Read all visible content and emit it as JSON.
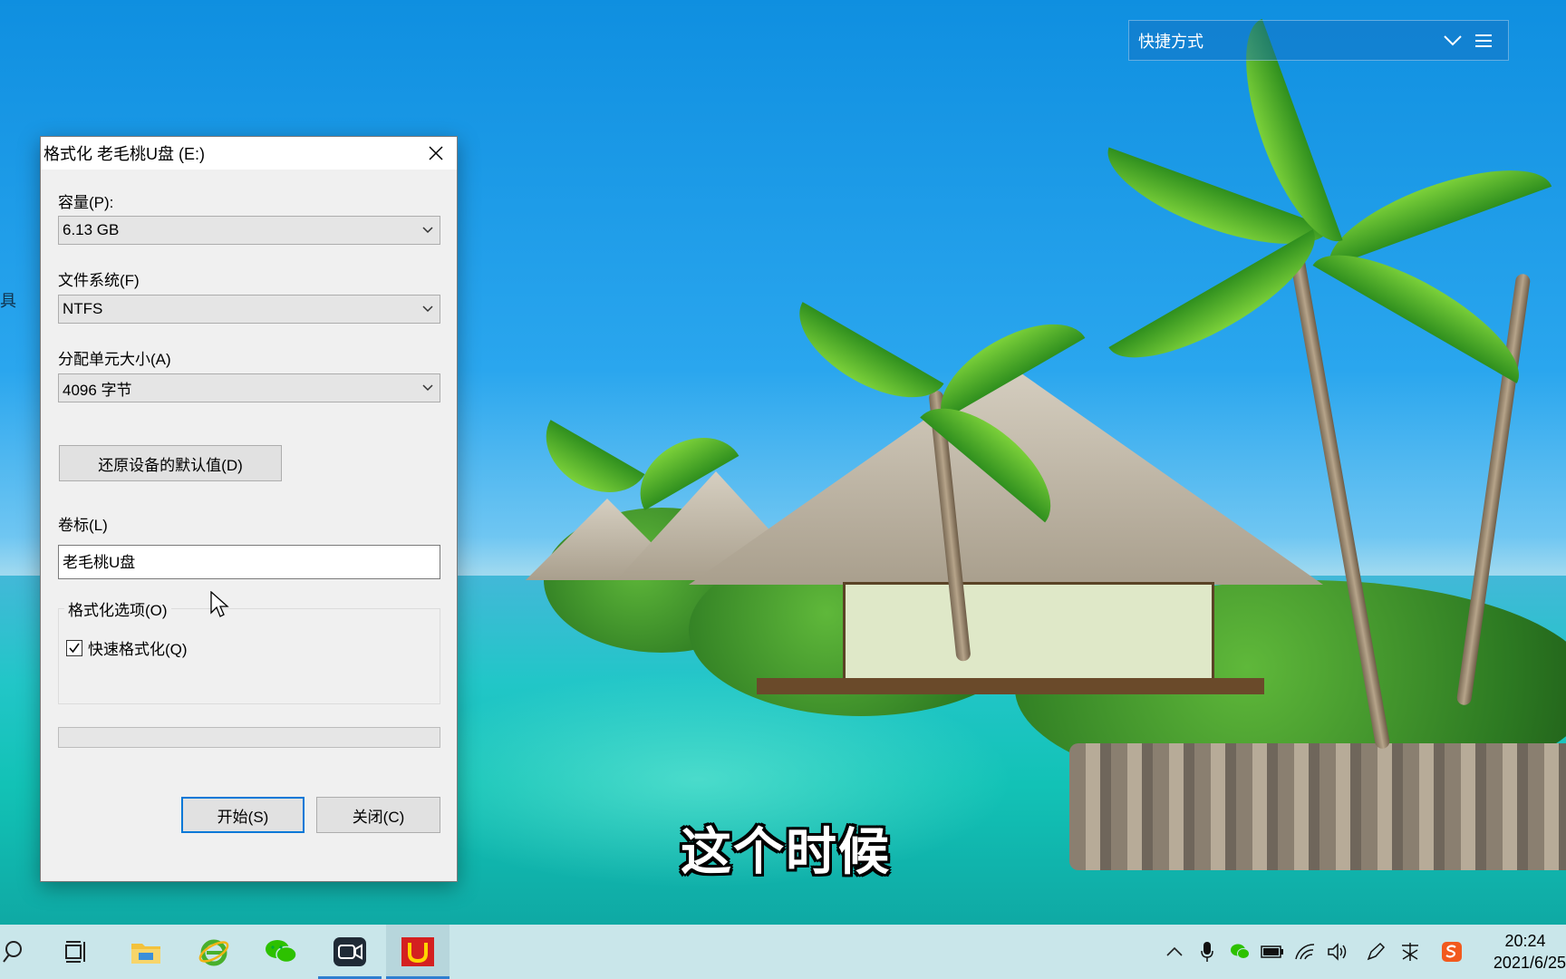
{
  "shortcut_bar": {
    "label": "快捷方式"
  },
  "desktop": {
    "side_fragment": "具"
  },
  "dialog": {
    "title": "格式化 老毛桃U盘 (E:)",
    "capacity": {
      "label": "容量(P):",
      "value": "6.13 GB"
    },
    "file_system": {
      "label": "文件系统(F)",
      "value": "NTFS"
    },
    "allocation": {
      "label": "分配单元大小(A)",
      "value": "4096 字节"
    },
    "restore_defaults_label": "还原设备的默认值(D)",
    "volume_label": {
      "label": "卷标(L)",
      "value": "老毛桃U盘"
    },
    "format_options": {
      "title": "格式化选项(O)",
      "quick_format_label": "快速格式化(Q)",
      "quick_format_checked": true
    },
    "progress_fraction": 0,
    "start_label": "开始(S)",
    "close_label": "关闭(C)"
  },
  "subtitle": "这个时候",
  "taskbar": {
    "apps": [
      "search-icon",
      "task-view-icon",
      "file-explorer-icon",
      "ie-browser-icon",
      "wechat-icon",
      "video-meeting-icon",
      "laomaotao-icon"
    ],
    "clock": {
      "time": "20:24",
      "date": "2021/6/25"
    }
  },
  "colors": {
    "accent": "#0078d7",
    "taskbar": "#c9e6ea",
    "dialog_bg": "#f0f0f0"
  }
}
